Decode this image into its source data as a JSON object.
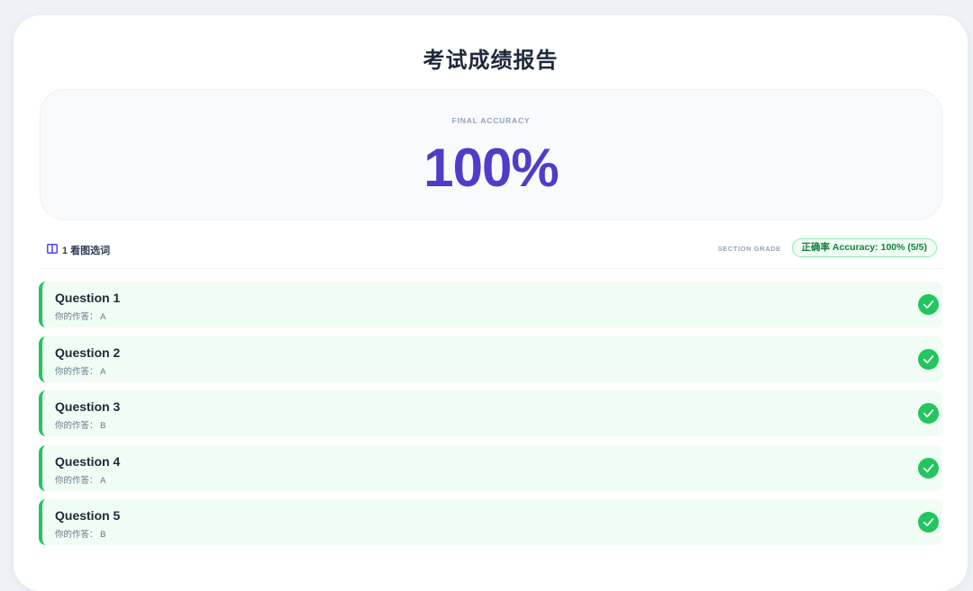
{
  "report": {
    "title": "考试成绩报告",
    "final_accuracy_label": "FINAL ACCURACY",
    "final_accuracy_value": "100%"
  },
  "section": {
    "icon": "book-open-icon",
    "title": "1 看图选词",
    "grade_label": "SECTION GRADE",
    "grade_badge": "正确率 Accuracy: 100% (5/5)"
  },
  "questions": [
    {
      "title": "Question 1",
      "answer": "你的作答： A",
      "status": "correct"
    },
    {
      "title": "Question 2",
      "answer": "你的作答： A",
      "status": "correct"
    },
    {
      "title": "Question 3",
      "answer": "你的作答： B",
      "status": "correct"
    },
    {
      "title": "Question 4",
      "answer": "你的作答： A",
      "status": "correct"
    },
    {
      "title": "Question 5",
      "answer": "你的作答： B",
      "status": "correct"
    }
  ],
  "colors": {
    "accent": "#4f3cc9",
    "correct": "#22c55e",
    "correct_bg": "#f0fdf4"
  }
}
